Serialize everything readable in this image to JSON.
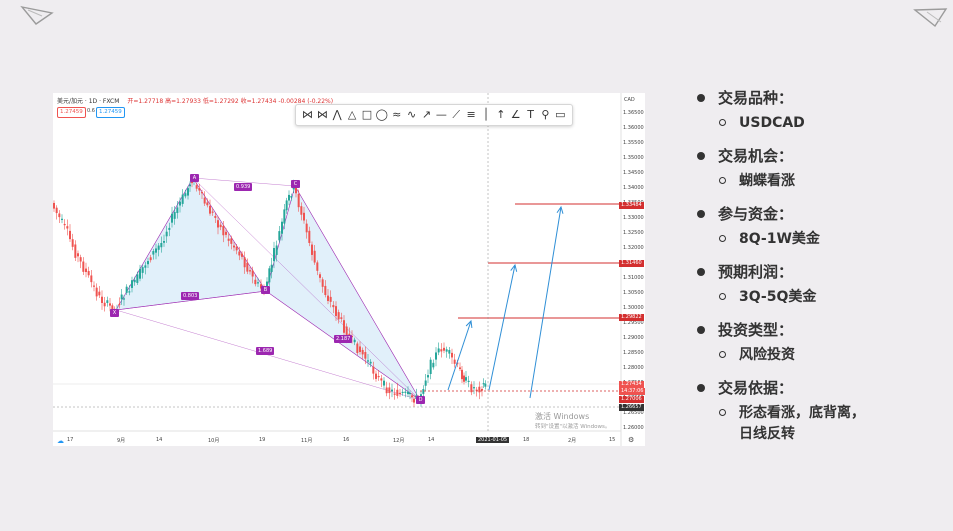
{
  "chart_header": {
    "symbol": "美元/加元 · 1D · FXCM",
    "ohlc": "开=1.27718 高=1.27933 低=1.27292 收=1.27434 -0.00284 (-0.22%)",
    "sell_price": "1.27459",
    "spread": "0.6",
    "buy_price": "1.27459",
    "currency": "CAD"
  },
  "toolbar_icons": [
    "xabcd-pattern-icon",
    "cypher-pattern-icon",
    "abcd-pattern-icon",
    "triangle-pattern-icon",
    "rectangle-icon",
    "ellipse-icon",
    "brush-icon",
    "path-icon",
    "ray-icon",
    "horizontal-line-icon",
    "trend-line-icon",
    "fib-retracement-icon",
    "vertical-line-icon",
    "arrow-icon",
    "angle-icon",
    "text-icon",
    "note-icon",
    "callout-icon"
  ],
  "price_axis": [
    "1.36500",
    "1.36000",
    "1.35500",
    "1.35000",
    "1.34500",
    "1.34000",
    "1.33500",
    "1.33000",
    "1.32500",
    "1.32000",
    "1.31500",
    "1.31000",
    "1.30500",
    "1.30000",
    "1.29500",
    "1.29000",
    "1.28500",
    "1.28000",
    "1.27500",
    "1.27000",
    "1.26500",
    "1.26000"
  ],
  "price_tags": {
    "target3": "1.33484",
    "target2": "1.31460",
    "target1": "1.29822",
    "close": "1.27434",
    "countdown": "14:37:06",
    "low_line": "1.27006",
    "crosshair": "1.26657"
  },
  "time_axis": [
    "17",
    "9月",
    "14",
    "10月",
    "19",
    "11月",
    "16",
    "12月",
    "14",
    "2021-01-05",
    "18",
    "2月",
    "15"
  ],
  "pattern_points": {
    "X": "X",
    "A": "A",
    "B": "B",
    "C": "C",
    "D": "D"
  },
  "pattern_ratios": {
    "xab": "0.803",
    "abc": "0.939",
    "bcd": "2.187",
    "xad": "1.689"
  },
  "watermark": {
    "line1": "激活 Windows",
    "line2": "转到\"设置\"以激活 Windows。"
  },
  "right_panel": [
    {
      "label": "交易品种：",
      "value": "USDCAD"
    },
    {
      "label": "交易机会：",
      "value": "蝴蝶看涨"
    },
    {
      "label": "参与资金：",
      "value": "8Q-1W美金"
    },
    {
      "label": "预期利润：",
      "value": "3Q-5Q美金"
    },
    {
      "label": "投资类型：",
      "value": "风险投资"
    },
    {
      "label": "交易依据：",
      "value": "形态看涨，底背离，\n日线反转"
    }
  ],
  "colors": {
    "up": "#26a69a",
    "down": "#ef5350",
    "pattern": "#9c27b0",
    "target_line": "#d32f2f",
    "arrow": "#2f8fd6"
  }
}
